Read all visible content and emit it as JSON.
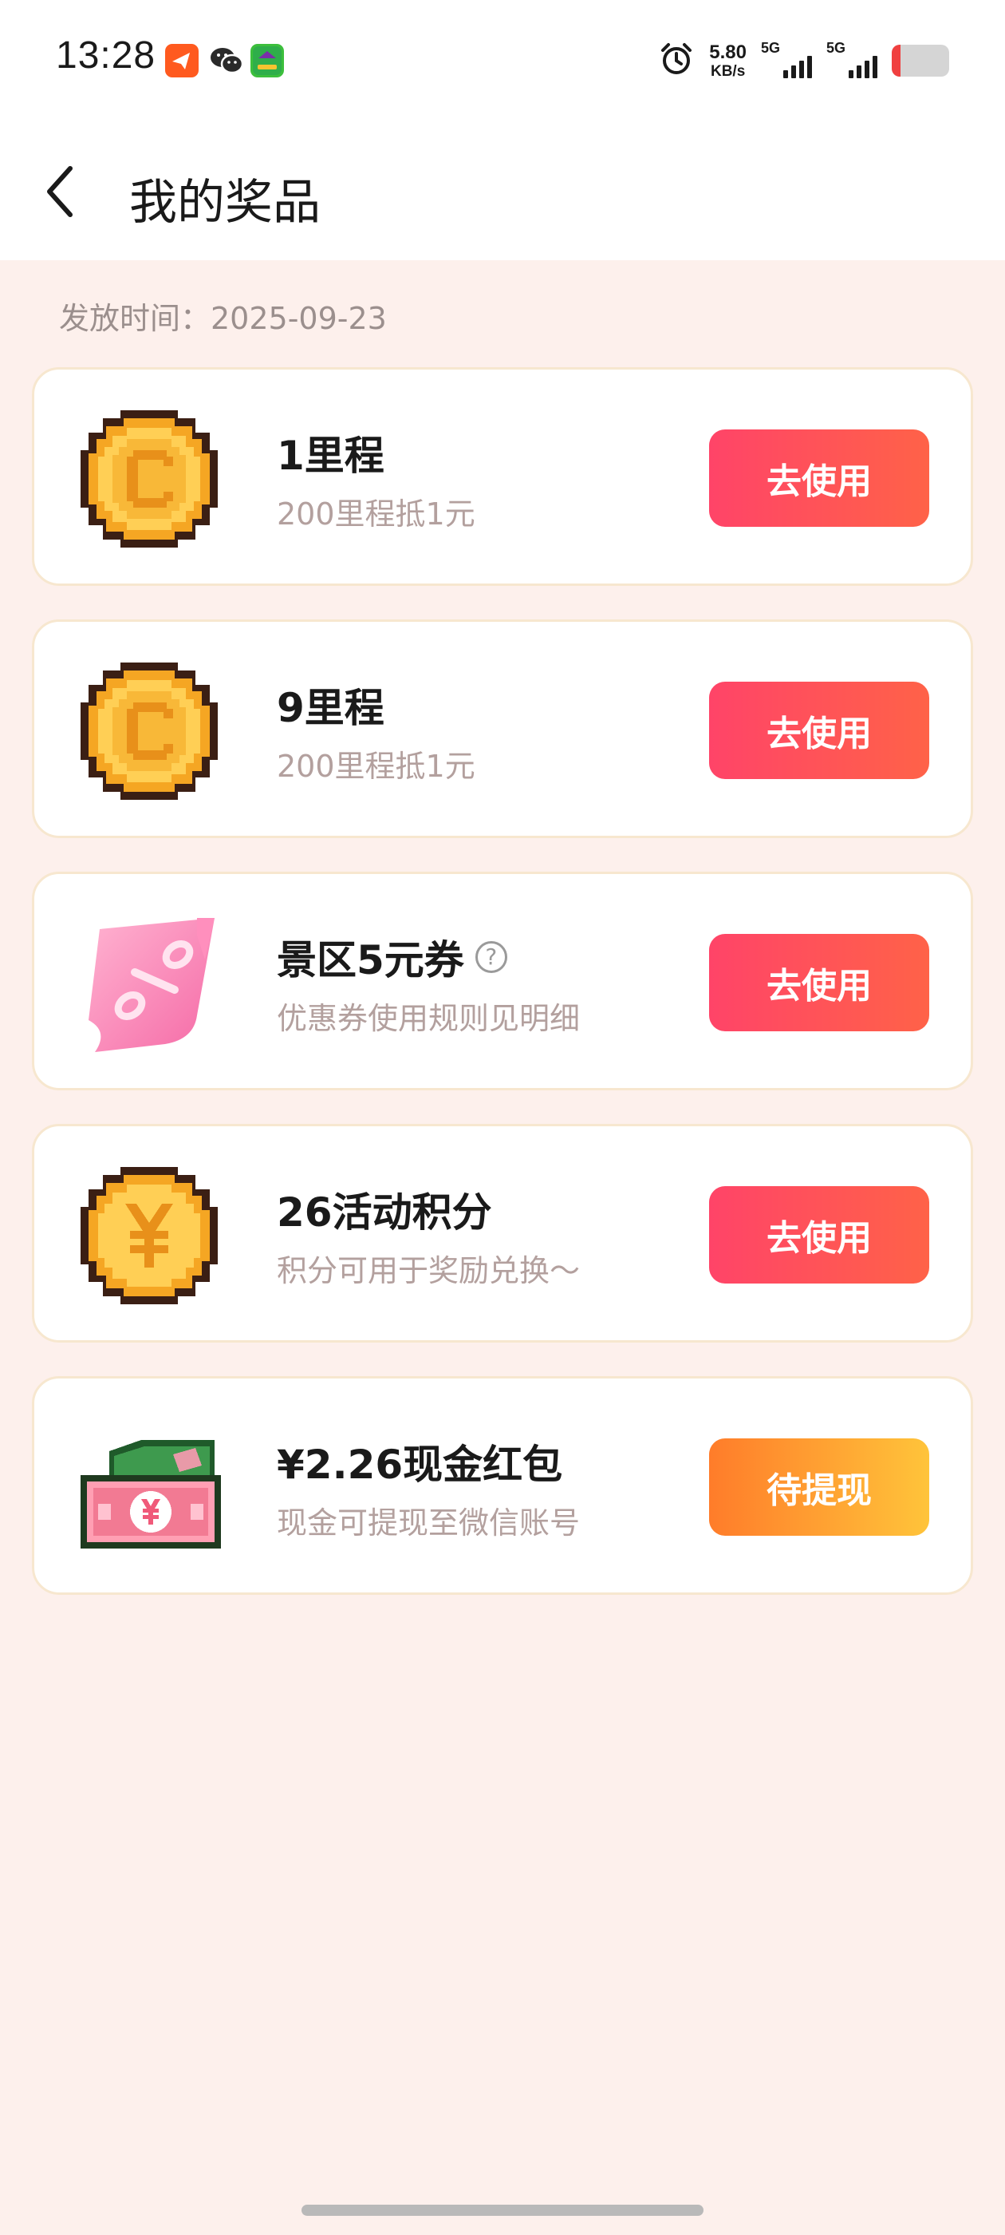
{
  "status_bar": {
    "time": "13:28",
    "net_speed_value": "5.80",
    "net_speed_unit": "KB/s",
    "signal_1_label": "5G",
    "signal_2_label": "5G",
    "battery_level_color": "#f04040"
  },
  "header": {
    "back_icon": "chevron-left-icon",
    "title": "我的奖品"
  },
  "issue_date": "发放时间：2025-09-23",
  "prizes": [
    {
      "name": "1里程",
      "desc": "200里程抵1元",
      "button": "去使用",
      "icon": "pixel-coin-c-icon"
    },
    {
      "name": "9里程",
      "desc": "200里程抵1元",
      "button": "去使用",
      "icon": "pixel-coin-c-icon"
    },
    {
      "name": "景区5元券",
      "desc": "优惠券使用规则见明细",
      "button": "去使用",
      "icon": "pink-coupon-icon",
      "help_icon": "?"
    },
    {
      "name": "26活动积分",
      "desc": "积分可用于奖励兑换～",
      "button": "去使用",
      "icon": "pixel-coin-yen-icon"
    },
    {
      "name": "¥2.26现金红包",
      "desc": "现金可提现至微信账号",
      "button": "待提现",
      "icon": "pixel-cash-icon"
    }
  ],
  "colors": {
    "page_bg": "#fdf0ec",
    "use_button": "#ff4468",
    "withdraw_button": "#ff7c2a",
    "card_border": "#f7e7cf"
  }
}
